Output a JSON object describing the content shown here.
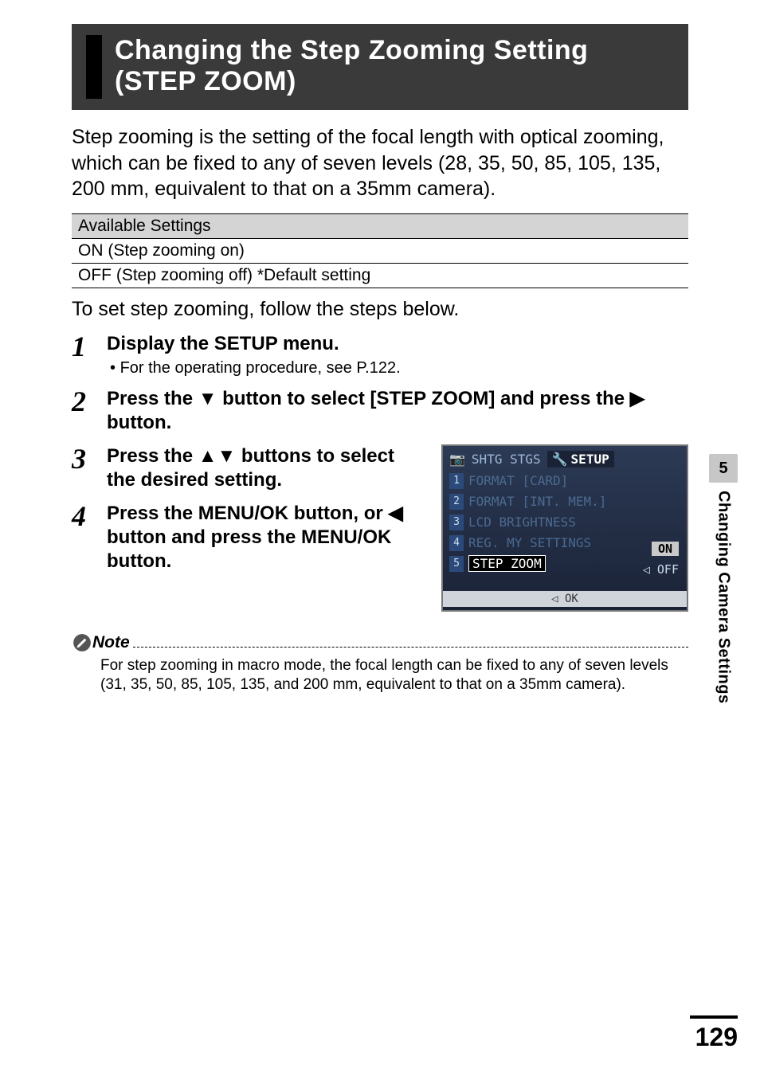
{
  "section_tab": {
    "number": "5",
    "label": "Changing Camera Settings"
  },
  "page_number": "129",
  "title": "Changing the Step Zooming Setting (STEP ZOOM)",
  "intro": "Step zooming is the setting of the focal length with optical zooming, which can be fixed to any of seven levels (28, 35, 50, 85, 105, 135, 200 mm, equivalent to that on a 35mm camera).",
  "settings_table": {
    "header": "Available Settings",
    "rows": [
      "ON (Step zooming on)",
      "OFF (Step zooming off) *Default setting"
    ]
  },
  "lead": "To set step zooming, follow the steps below.",
  "steps": [
    {
      "num": "1",
      "headline": "Display the SETUP menu.",
      "sub": "For the operating procedure, see P.122."
    },
    {
      "num": "2",
      "headline_parts": [
        "Press the ",
        "▼",
        " button to select [STEP ZOOM] and press the ",
        "▶",
        " button."
      ]
    },
    {
      "num": "3",
      "headline_parts": [
        "Press the ",
        "▲▼",
        " buttons to select the desired setting."
      ]
    },
    {
      "num": "4",
      "headline_parts": [
        "Press the MENU/OK button, or ",
        "◀",
        " button and press the MENU/OK button."
      ]
    }
  ],
  "screenshot": {
    "top_left": "SHTG STGS",
    "top_right": "SETUP",
    "rows": [
      {
        "n": "1",
        "label": "FORMAT  [CARD]"
      },
      {
        "n": "2",
        "label": "FORMAT  [INT. MEM.]"
      },
      {
        "n": "3",
        "label": "LCD BRIGHTNESS"
      },
      {
        "n": "4",
        "label": "REG. MY SETTINGS"
      },
      {
        "n": "5",
        "label": "STEP ZOOM"
      }
    ],
    "value_on": "ON",
    "value_off": "OFF",
    "ok_hint": "◁ OK"
  },
  "note": {
    "label": "Note",
    "text": "For step zooming in macro mode, the focal length can be fixed to any of seven levels (31, 35, 50, 85, 105, 135, and 200 mm, equivalent to that on a 35mm camera)."
  }
}
